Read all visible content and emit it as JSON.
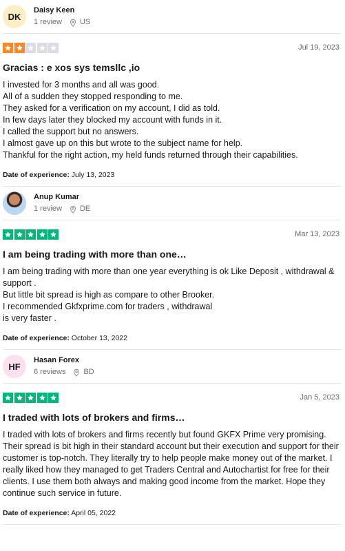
{
  "colors": {
    "star_orange": "#ff8622",
    "star_green": "#00b67a",
    "star_empty": "#dcdce6"
  },
  "reviews": [
    {
      "initials": "DK",
      "avatar_color": "#fcefc5",
      "name": "Daisy Keen",
      "review_count": "1 review",
      "country": "US",
      "rating": 2,
      "date": "Jul 19, 2023",
      "title": "Gracias : e xos sys temsllc ,io",
      "lines": [
        "I invested for 3 months and all was good.",
        "All of a sudden they stopped responding to me.",
        "They asked for a verification on my account, I did as told.",
        "In few days later they blocked my account with funds in it.",
        "I called the support but no answers.",
        "I almost gave up on this but wrote to the subject name for help.",
        "Thankful for the right action, my held funds returned through their capabilities."
      ],
      "exp_label": "Date of experience:",
      "exp_date": "July 13, 2023"
    },
    {
      "initials": "",
      "avatar_color": "#b9d7f3",
      "name": "Anup Kumar",
      "review_count": "1 review",
      "country": "DE",
      "rating": 5,
      "date": "Mar 13, 2023",
      "title": "I am being trading with more than one…",
      "lines": [
        "I am being trading with more than one year everything is ok Like Deposit , withdrawal & support .",
        "But little bit spread is high as compare to other Brooker.",
        "I recommended Gkfxprime.com for traders , withdrawal",
        "is very faster ."
      ],
      "exp_label": "Date of experience:",
      "exp_date": "October 13, 2022"
    },
    {
      "initials": "HF",
      "avatar_color": "#fde0ee",
      "name": "Hasan Forex",
      "review_count": "6 reviews",
      "country": "BD",
      "rating": 5,
      "date": "Jan 5, 2023",
      "title": "I traded with lots of brokers and firms…",
      "lines": [
        "I traded with lots of brokers and firms recently but found GKFX Prime very promising. Their spread is bit high in their standard account but their execution and support for their customer is top-notch. They literally try to help people make money out of the market. I really liked how they managed to get Traders Central and Autochartist for free for their clients. I use them both always and making good income from the market. Hope they continue such service in future."
      ],
      "exp_label": "Date of experience:",
      "exp_date": "April 05, 2022"
    }
  ]
}
